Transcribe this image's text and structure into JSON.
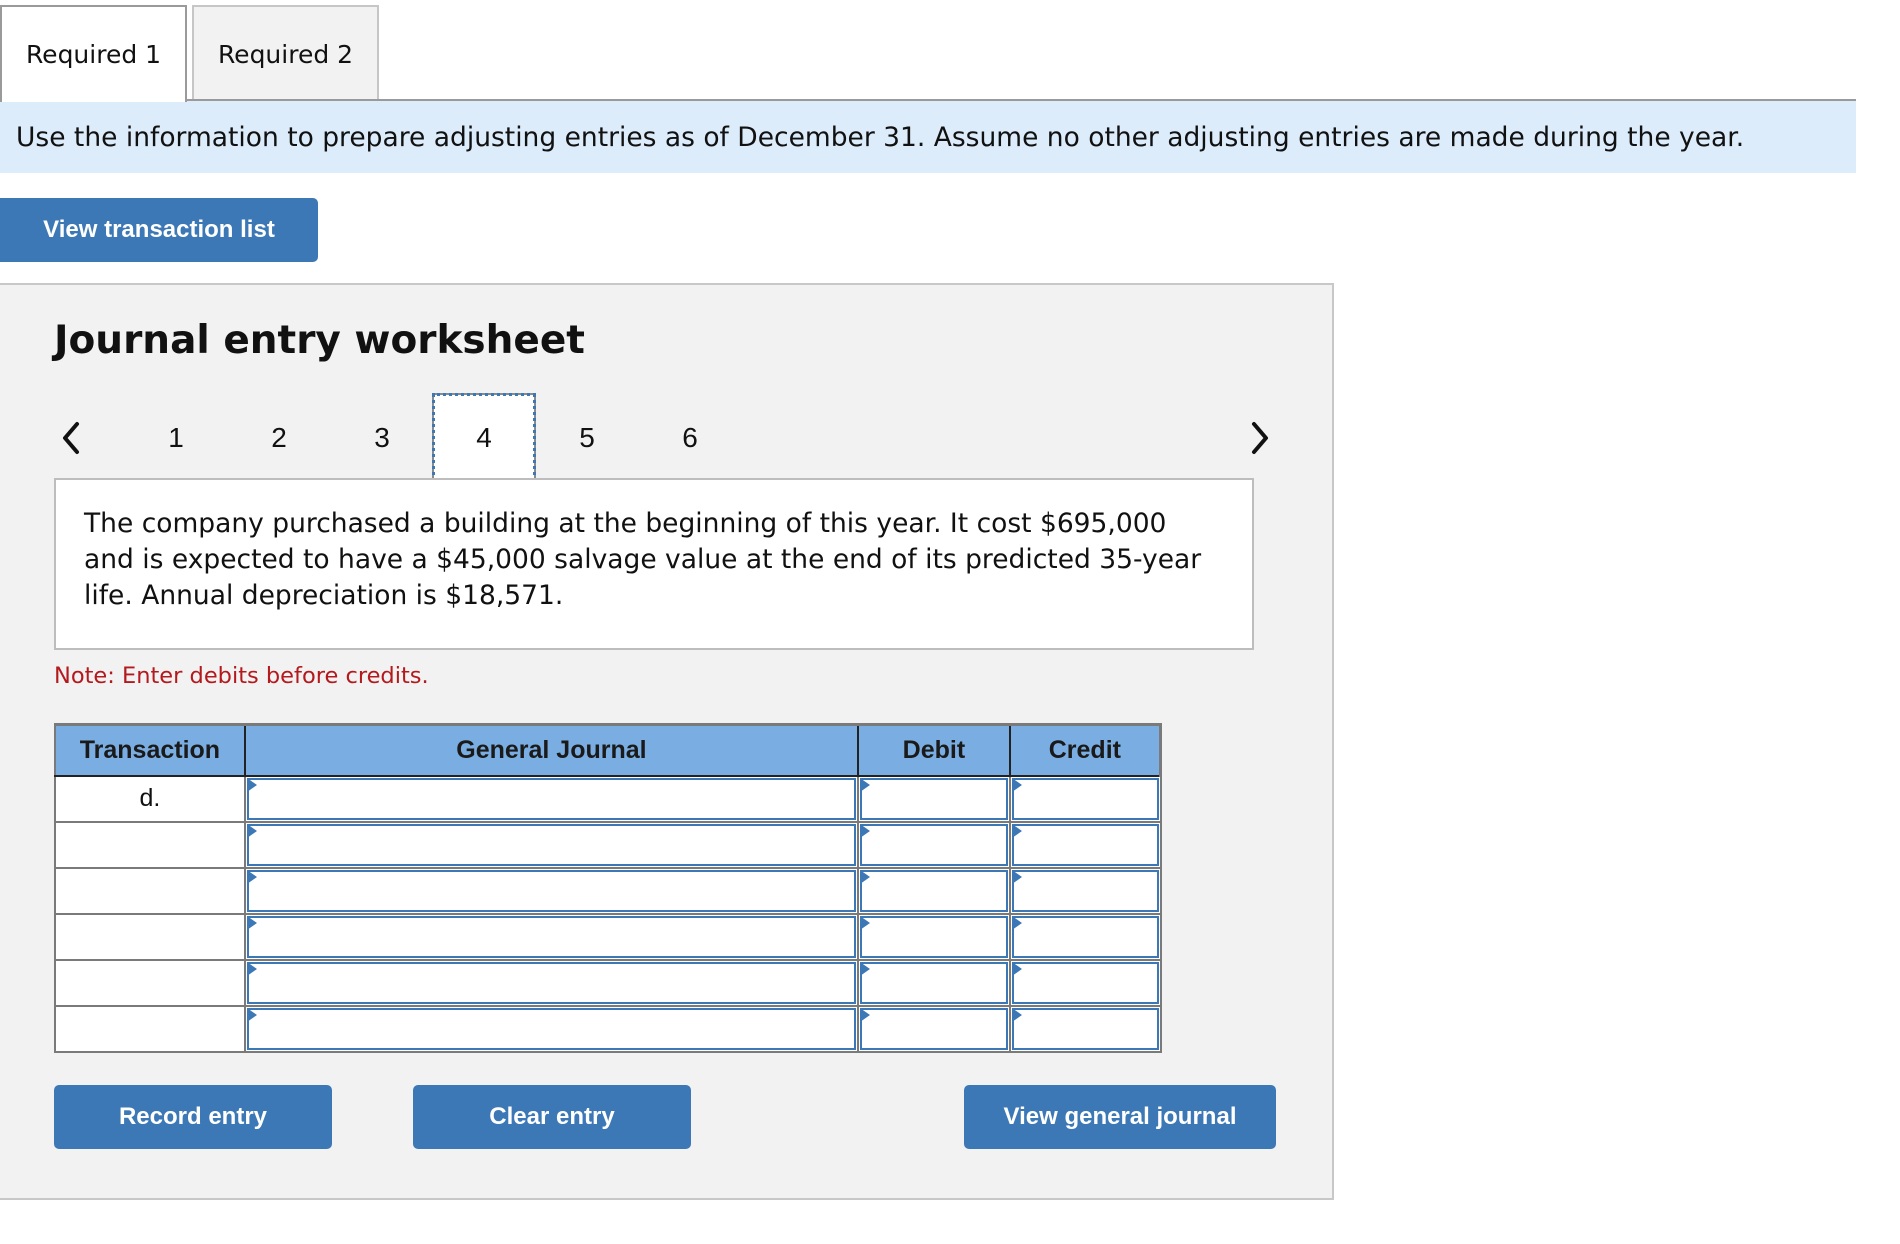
{
  "tabs": [
    {
      "label": "Required 1",
      "active": true
    },
    {
      "label": "Required 2",
      "active": false
    }
  ],
  "instructions": "Use the information to prepare adjusting entries as of December 31. Assume no other adjusting entries are made during the year.",
  "buttons": {
    "view_transaction_list": "View transaction list",
    "record_entry": "Record entry",
    "clear_entry": "Clear entry",
    "view_general_journal": "View general journal"
  },
  "worksheet": {
    "title": "Journal entry worksheet",
    "pager": {
      "prev_icon": "chevron-left-icon",
      "next_icon": "chevron-right-icon",
      "pages": [
        "1",
        "2",
        "3",
        "4",
        "5",
        "6"
      ],
      "current": "4"
    },
    "description": "The company purchased a building at the beginning of this year. It cost $695,000 and is expected to have a $45,000 salvage value at the end of its predicted 35-year life. Annual depreciation is $18,571.",
    "note": "Note: Enter debits before credits."
  },
  "journal_table": {
    "columns": [
      "Transaction",
      "General Journal",
      "Debit",
      "Credit"
    ],
    "rows": [
      {
        "transaction": "d.",
        "account": "",
        "debit": "",
        "credit": ""
      },
      {
        "transaction": "",
        "account": "",
        "debit": "",
        "credit": ""
      },
      {
        "transaction": "",
        "account": "",
        "debit": "",
        "credit": ""
      },
      {
        "transaction": "",
        "account": "",
        "debit": "",
        "credit": ""
      },
      {
        "transaction": "",
        "account": "",
        "debit": "",
        "credit": ""
      },
      {
        "transaction": "",
        "account": "",
        "debit": "",
        "credit": ""
      }
    ]
  },
  "colors": {
    "accent": "#3d78b6",
    "header_bg": "#7aaee2",
    "banner_bg": "#dcecfa",
    "panel_bg": "#f2f2f2",
    "note": "#b3191d"
  }
}
